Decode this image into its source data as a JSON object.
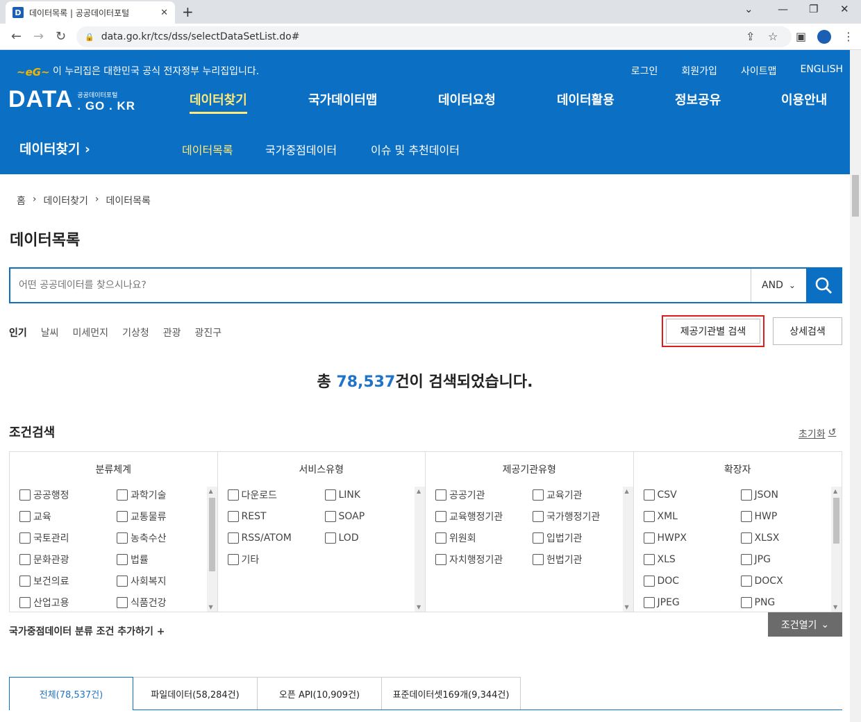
{
  "browser": {
    "tab_title": "데이터목록 | 공공데이터포털",
    "favicon_letter": "D",
    "url": "data.go.kr/tcs/dss/selectDataSetList.do#"
  },
  "header": {
    "gov_banner": "이 누리집은 대한민국 공식 전자정부 누리집입니다.",
    "util_links": [
      "로그인",
      "회원가입",
      "사이트맵",
      "ENGLISH"
    ],
    "logo_main": "DATA",
    "logo_sub_small": "공공데이터포털",
    "logo_sub_big": ". GO . KR",
    "gnb": [
      "데이터찾기",
      "국가데이터맵",
      "데이터요청",
      "데이터활용",
      "정보공유",
      "이용안내"
    ],
    "subnav_title": "데이터찾기",
    "subnav": [
      "데이터목록",
      "국가중점데이터",
      "이슈 및 추천데이터"
    ]
  },
  "breadcrumb": [
    "홈",
    "데이터찾기",
    "데이터목록"
  ],
  "page_title": "데이터목록",
  "search": {
    "placeholder": "어떤 공공데이터를 찾으시나요?",
    "operator": "AND"
  },
  "popular": {
    "label": "인기",
    "keywords": [
      "날씨",
      "미세먼지",
      "기상청",
      "관광",
      "광진구"
    ]
  },
  "buttons": {
    "org_search": "제공기관별 검색",
    "detail_search": "상세검색",
    "open_conditions": "조건열기",
    "reset": "초기화"
  },
  "result": {
    "prefix": "총 ",
    "count": "78,537",
    "suffix": "건이 검색되었습니다."
  },
  "conditions": {
    "title": "조건검색",
    "add_label": "국가중점데이터 분류 조건 추가하기",
    "columns": [
      {
        "header": "분류체계",
        "items": [
          "공공행정",
          "과학기술",
          "교육",
          "교통물류",
          "국토관리",
          "농축수산",
          "문화관광",
          "법률",
          "보건의료",
          "사회복지",
          "산업고용",
          "식품건강"
        ]
      },
      {
        "header": "서비스유형",
        "items": [
          "다운로드",
          "LINK",
          "REST",
          "SOAP",
          "RSS/ATOM",
          "LOD",
          "기타"
        ]
      },
      {
        "header": "제공기관유형",
        "items": [
          "공공기관",
          "교육기관",
          "교육행정기관",
          "국가행정기관",
          "위원회",
          "입법기관",
          "자치행정기관",
          "헌법기관"
        ]
      },
      {
        "header": "확장자",
        "items": [
          "CSV",
          "JSON",
          "XML",
          "HWP",
          "HWPX",
          "XLSX",
          "XLS",
          "JPG",
          "DOC",
          "DOCX",
          "JPEG",
          "PNG"
        ]
      }
    ]
  },
  "result_tabs": [
    "전체(78,537건)",
    "파일데이터(58,284건)",
    "오픈 API(10,909건)",
    "표준데이터셋169개(9,344건)"
  ],
  "colors": {
    "brand_blue": "#0b6fc4",
    "active_yellow": "#ffe97a",
    "highlight_red": "#e01b1b"
  }
}
